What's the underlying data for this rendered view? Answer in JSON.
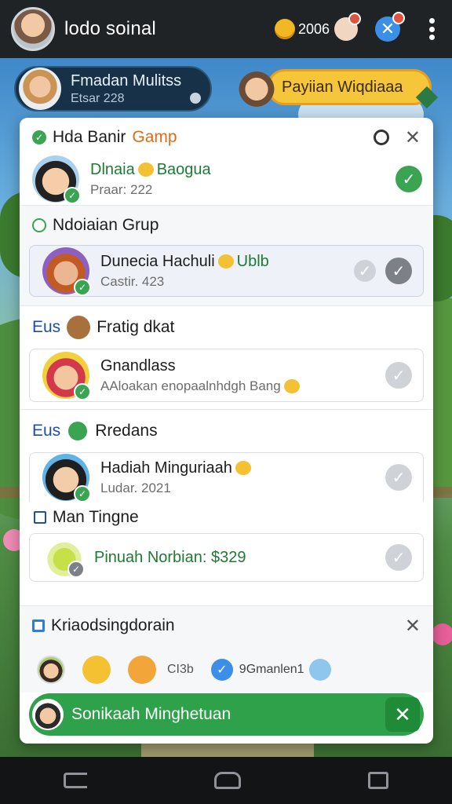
{
  "topbar": {
    "title": "lodo soinal",
    "coin_count": "2006"
  },
  "profile": {
    "name": "Fmadan Mulitss",
    "sub": "Etsar 228"
  },
  "banner": {
    "label": "Payiian Wiqdiaaa"
  },
  "panel": {
    "section1": {
      "title": "Hda Banir",
      "accent": "Gamp",
      "row": {
        "title": "Dlnaia",
        "title_suffix": "Baogua",
        "sub": "Praar: 222"
      }
    },
    "section2": {
      "title": "Ndoiaian Grup",
      "row": {
        "title": "Dunecia Hachuli",
        "title_suffix": "Ublb",
        "sub": "Castir. 423"
      }
    },
    "section3": {
      "prefix": "Eus",
      "title": "Fratig dkat",
      "row": {
        "title": "Gnandlass",
        "sub": "AAloakan enopaalnhdgh Bang"
      }
    },
    "section4": {
      "prefix": "Eus",
      "title": "Rredans",
      "row1": {
        "title": "Hadiah Minguriaah",
        "sub": "Ludar. 2021"
      },
      "sub_title": "Man Tingne",
      "row2": {
        "title": "Pinuah Norbian: $329"
      }
    },
    "section5": {
      "title": "Kriaodsingdorain",
      "reactions": {
        "small_label": "CI3b",
        "label": "9Gmanlen1"
      }
    },
    "toast": {
      "text": "Sonikaah Minghetuan"
    }
  },
  "colors": {
    "accent_green": "#3aa453",
    "accent_orange": "#e06b16",
    "banner_yellow": "#f5c53a",
    "topbar_dark": "#1f2326"
  },
  "icons": [
    "coin-icon",
    "moon-badge-icon",
    "close-icon",
    "more-vertical-icon",
    "paperclip-icon",
    "check-icon",
    "back-icon",
    "home-icon",
    "recent-apps-icon"
  ]
}
